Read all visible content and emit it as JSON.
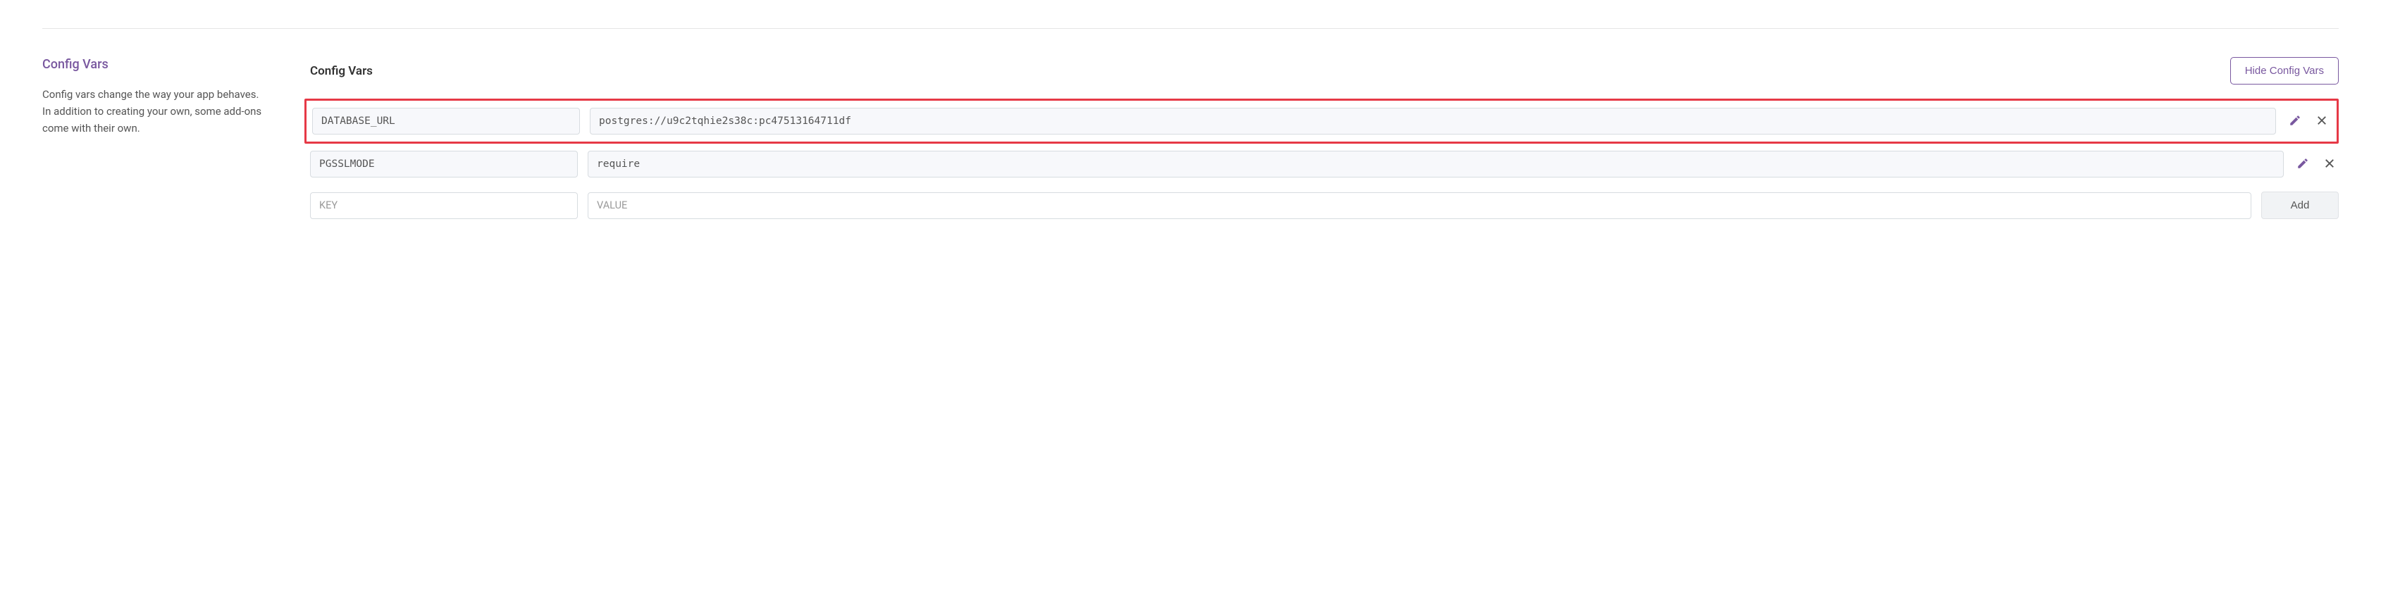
{
  "sidebar": {
    "title": "Config Vars",
    "description": "Config vars change the way your app behaves. In addition to creating your own, some add-ons come with their own."
  },
  "main": {
    "title": "Config Vars",
    "hide_button_label": "Hide Config Vars",
    "rows": [
      {
        "key": "DATABASE_URL",
        "value": "postgres://u9c2tqhie2s38c:pc47513164711df"
      },
      {
        "key": "PGSSLMODE",
        "value": "require"
      }
    ],
    "new_row": {
      "key_placeholder": "KEY",
      "value_placeholder": "VALUE",
      "add_label": "Add"
    }
  }
}
